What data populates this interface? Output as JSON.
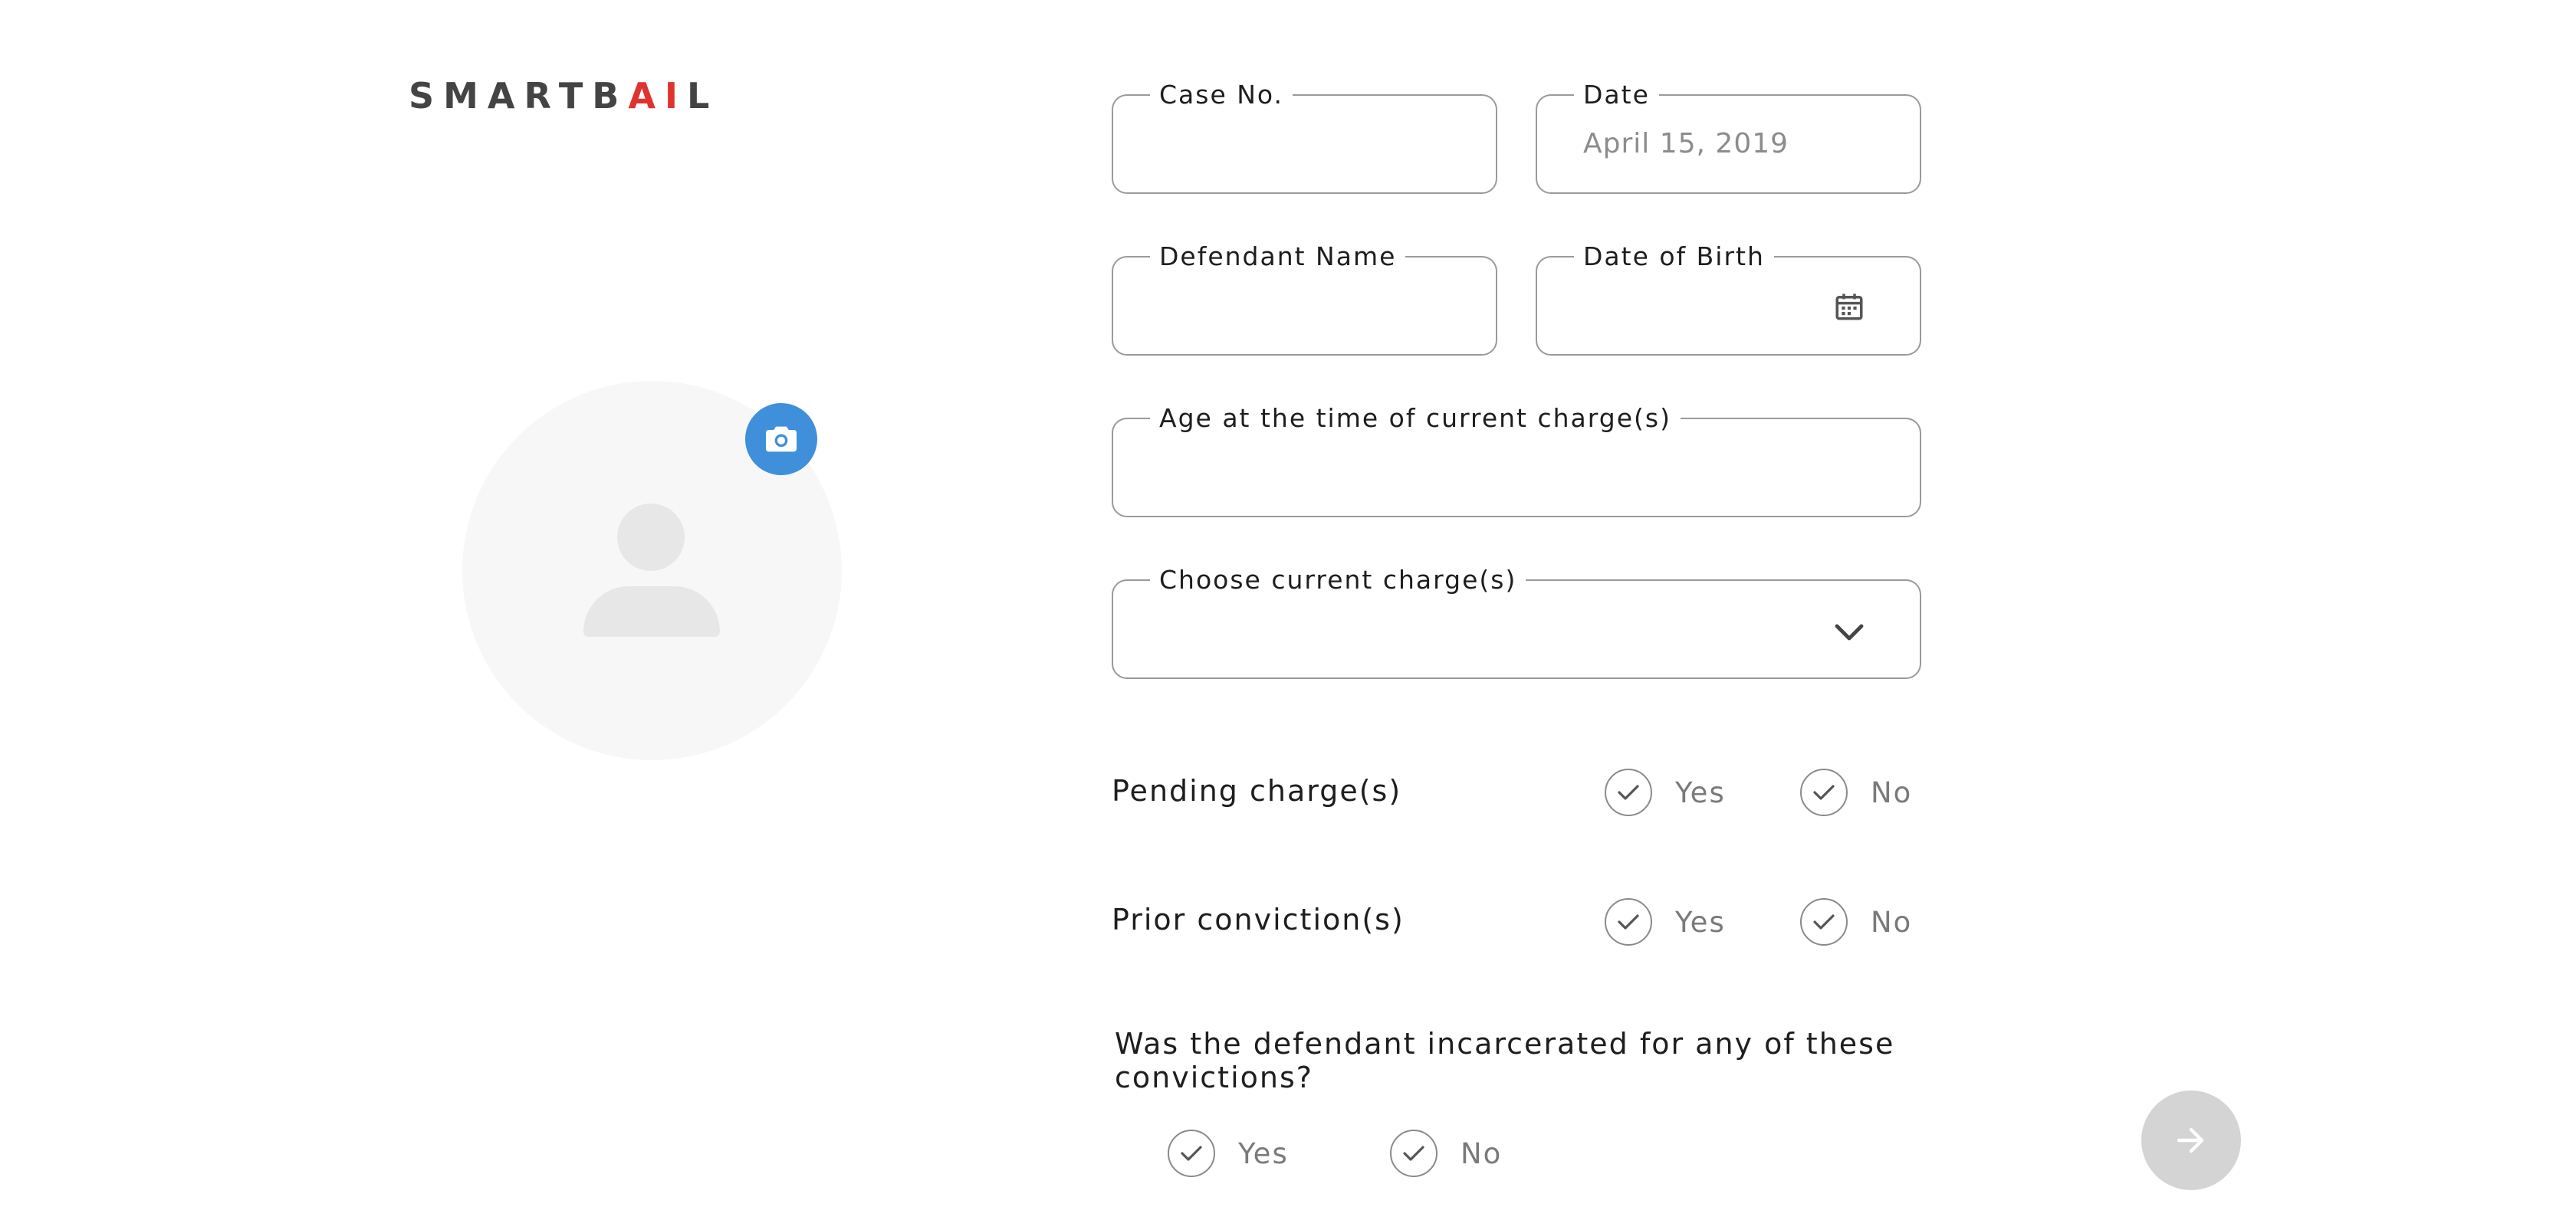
{
  "brand": {
    "logo_start": "SMARTB",
    "logo_accent": "AI",
    "logo_end": "L",
    "accent_color": "#e0332f",
    "text_color": "#444444"
  },
  "avatar": {
    "icon": "person-silhouette-icon",
    "camera_icon": "camera-icon",
    "camera_color": "#3f8fdb"
  },
  "form": {
    "case_no": {
      "label": "Case No.",
      "value": ""
    },
    "date": {
      "label": "Date",
      "value": "",
      "placeholder": "April 15, 2019"
    },
    "defendant_name": {
      "label": "Defendant Name",
      "value": ""
    },
    "date_of_birth": {
      "label": "Date of Birth",
      "value": "",
      "icon": "calendar-icon"
    },
    "age": {
      "label": "Age at the time of current charge(s)",
      "value": ""
    },
    "charges": {
      "label": "Choose current charge(s)",
      "value": "",
      "icon": "chevron-down-icon"
    }
  },
  "questions": {
    "pending": {
      "text": "Pending charge(s)",
      "yes": "Yes",
      "no": "No"
    },
    "prior": {
      "text": "Prior conviction(s)",
      "yes": "Yes",
      "no": "No"
    },
    "incarcerated": {
      "text": "Was the defendant incarcerated for any of these convictions?",
      "yes": "Yes",
      "no": "No"
    }
  },
  "navigation": {
    "next_icon": "arrow-right-icon",
    "next_color": "#d4d4d4"
  }
}
